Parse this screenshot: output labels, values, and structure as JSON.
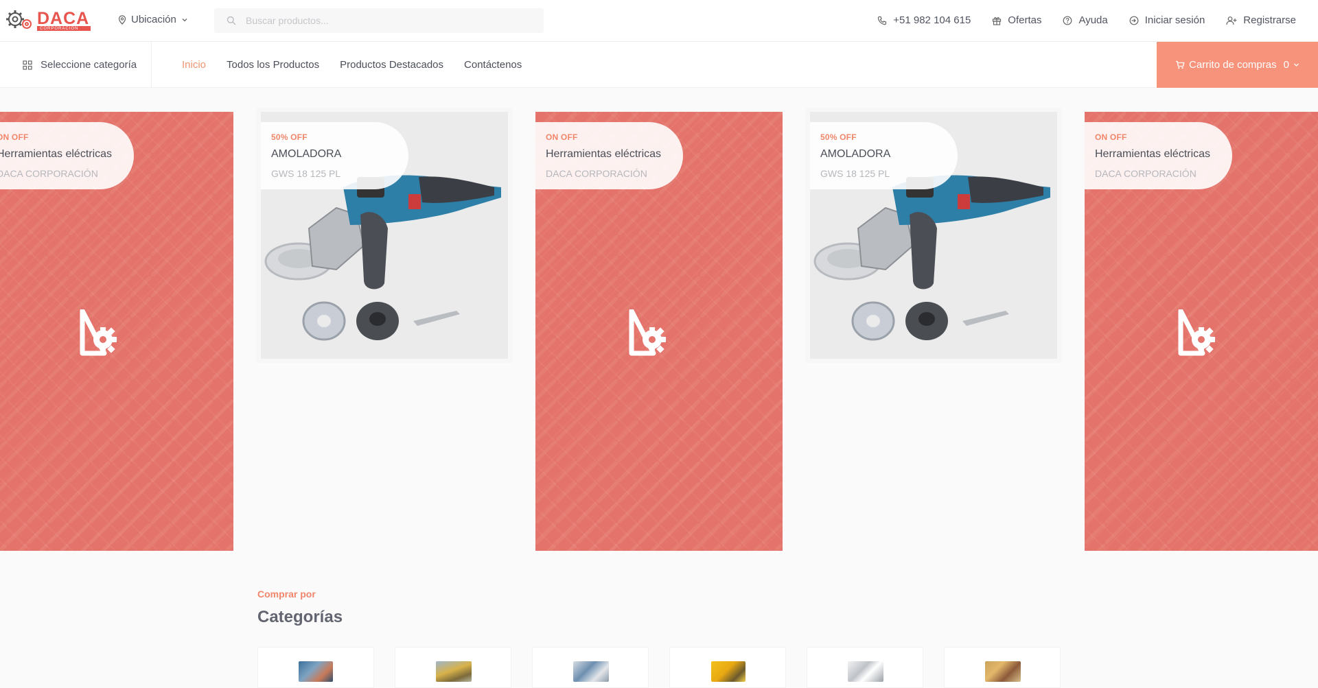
{
  "header": {
    "logo_text": "DACA",
    "logo_sub": "CORPORACIÓN",
    "location_label": "Ubicación",
    "search_placeholder": "Buscar productos...",
    "links": [
      {
        "label": "+51 982 104 615",
        "icon": "phone-icon"
      },
      {
        "label": "Ofertas",
        "icon": "gift-icon"
      },
      {
        "label": "Ayuda",
        "icon": "help-icon"
      },
      {
        "label": "Iniciar sesión",
        "icon": "login-icon"
      },
      {
        "label": "Registrarse",
        "icon": "user-plus-icon"
      }
    ]
  },
  "nav": {
    "category_label": "Seleccione categoría",
    "links": [
      "Inicio",
      "Todos los Productos",
      "Productos Destacados",
      "Contáctenos"
    ],
    "active": "Inicio",
    "cart_label": "Carrito de compras",
    "cart_count": "0"
  },
  "slides": [
    {
      "type": "banner",
      "tag": "ON OFF",
      "title": "Herramientas eléctricas",
      "subtitle": "DACA CORPORACIÓN"
    },
    {
      "type": "product",
      "tag": "50% OFF",
      "title": "AMOLADORA",
      "subtitle": "GWS 18 125 PL"
    },
    {
      "type": "banner",
      "tag": "ON OFF",
      "title": "Herramientas eléctricas",
      "subtitle": "DACA CORPORACIÓN"
    },
    {
      "type": "product",
      "tag": "50% OFF",
      "title": "AMOLADORA",
      "subtitle": "GWS 18 125 PL"
    },
    {
      "type": "banner",
      "tag": "ON OFF",
      "title": "Herramientas eléctricas",
      "subtitle": "DACA CORPORACIÓN"
    }
  ],
  "categories_section": {
    "kicker": "Comprar por",
    "title": "Categorías"
  },
  "colors": {
    "accent": "#f0866a",
    "cart_bg": "#f6937a",
    "banner_red": "#e4736b"
  }
}
